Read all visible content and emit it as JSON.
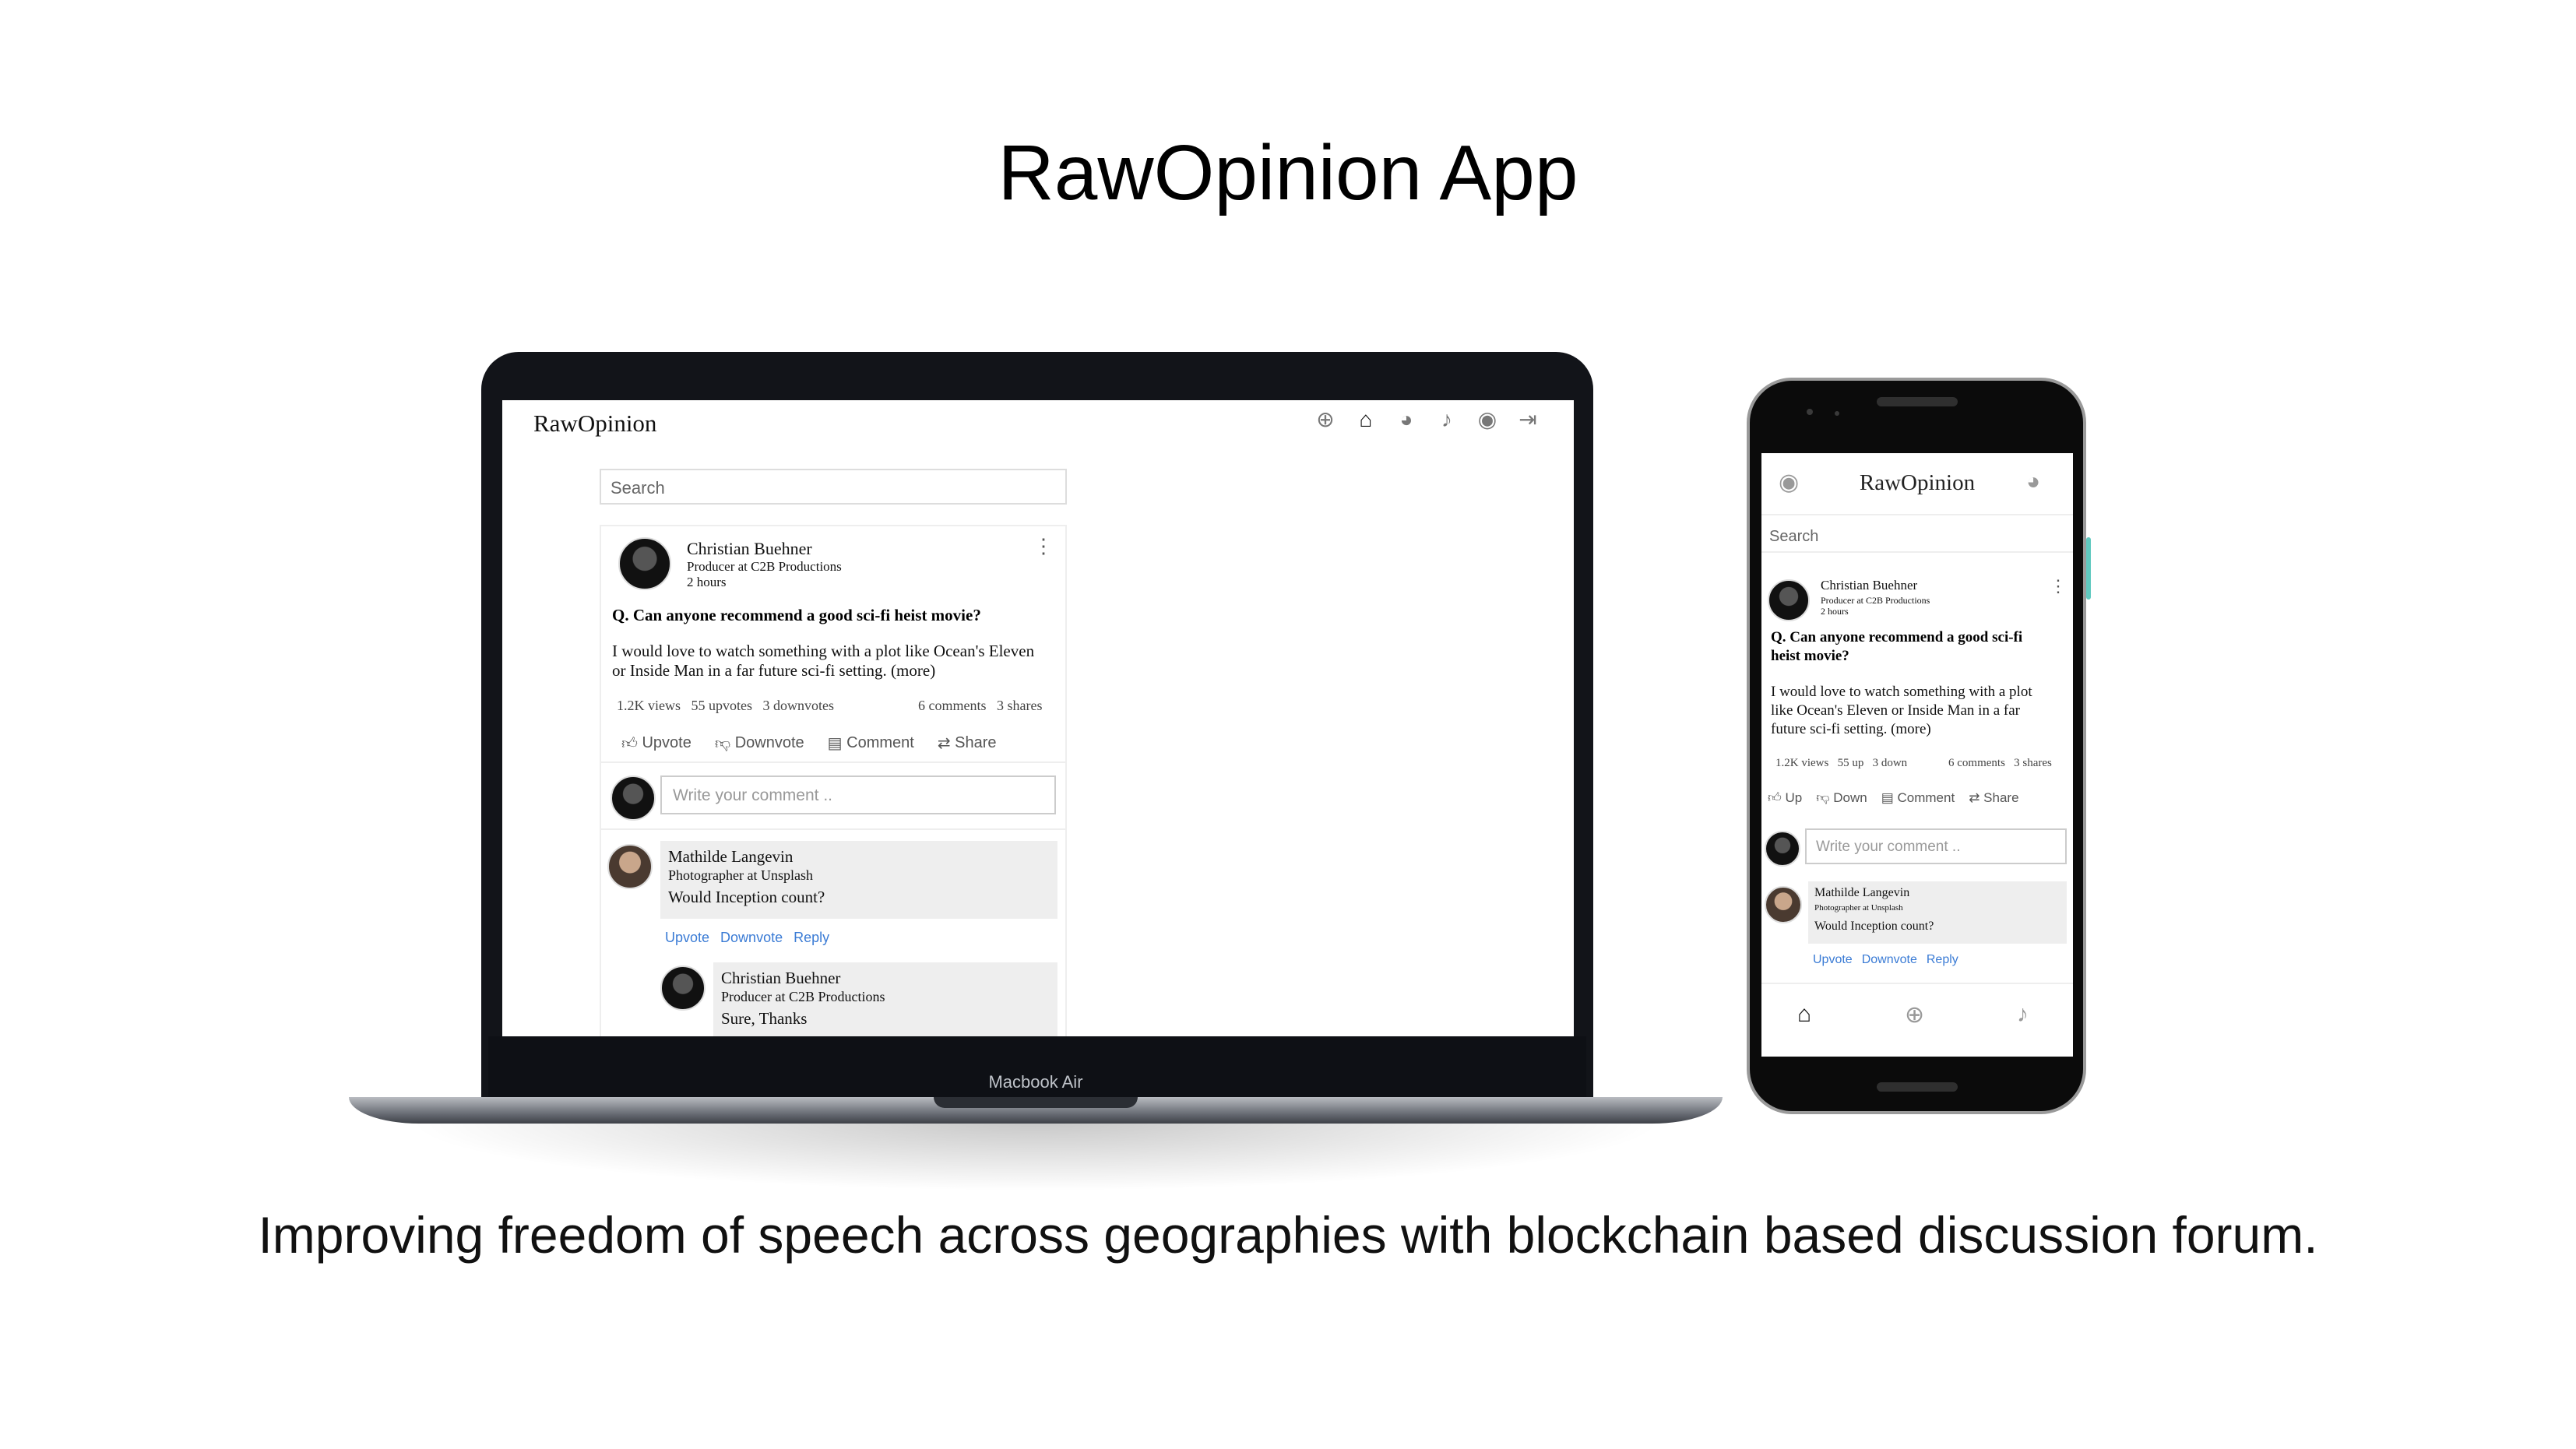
{
  "slide": {
    "title": "RawOpinion App",
    "tagline": "Improving freedom of speech across geographies with blockchain based discussion forum."
  },
  "laptop": {
    "model_label": "Macbook Air",
    "app": {
      "brand": "RawOpinion",
      "nav_icons": [
        "add-circle-icon",
        "home-icon",
        "messenger-icon",
        "bell-icon",
        "user-circle-icon",
        "logout-icon"
      ],
      "active_icon": "home-icon",
      "search_placeholder": "Search",
      "post": {
        "author": "Christian Buehner",
        "author_title": "Producer at C2B Productions",
        "time": "2 hours",
        "question": "Q. Can anyone recommend a good sci-fi heist movie?",
        "body_line1": "I would love to watch something with a plot like Ocean's Eleven",
        "body_line2": "or Inside Man in a far future sci-fi setting. (more)",
        "views": "1.2K views",
        "upvotes": "55 upvotes",
        "downvotes": "3 downvotes",
        "comments": "6 comments",
        "shares": "3 shares",
        "actions": {
          "upvote": "Upvote",
          "downvote": "Downvote",
          "comment": "Comment",
          "share": "Share"
        },
        "comment_placeholder": "Write your comment ..",
        "comment1": {
          "author": "Mathilde Langevin",
          "author_title": "Photographer at Unsplash",
          "text": "Would Inception count?",
          "links": {
            "upvote": "Upvote",
            "downvote": "Downvote",
            "reply": "Reply"
          }
        },
        "reply1": {
          "author": "Christian Buehner",
          "author_title": "Producer at C2B Productions",
          "text": "Sure, Thanks"
        }
      }
    }
  },
  "phone": {
    "app": {
      "brand": "RawOpinion",
      "search_placeholder": "Search",
      "post": {
        "author": "Christian Buehner",
        "author_title": "Producer at C2B Productions",
        "time": "2 hours",
        "question_line1": "Q. Can anyone recommend a good sci-fi",
        "question_line2": "heist movie?",
        "body_line1": "I would love to watch something with a plot",
        "body_line2": "like Ocean's Eleven or Inside Man in a far",
        "body_line3": "future sci-fi setting. (more)",
        "views": "1.2K views",
        "up": "55 up",
        "down": "3 down",
        "comments": "6 comments",
        "shares": "3 shares",
        "actions": {
          "up": "Up",
          "down": "Down",
          "comment": "Comment",
          "share": "Share"
        },
        "comment_placeholder": "Write your comment ..",
        "comment1": {
          "author": "Mathilde Langevin",
          "author_title": "Photographer at Unsplash",
          "text": "Would Inception count?",
          "links": {
            "upvote": "Upvote",
            "downvote": "Downvote",
            "reply": "Reply"
          }
        }
      },
      "bottom_nav": [
        "home-icon",
        "add-circle-icon",
        "bell-icon"
      ]
    }
  }
}
